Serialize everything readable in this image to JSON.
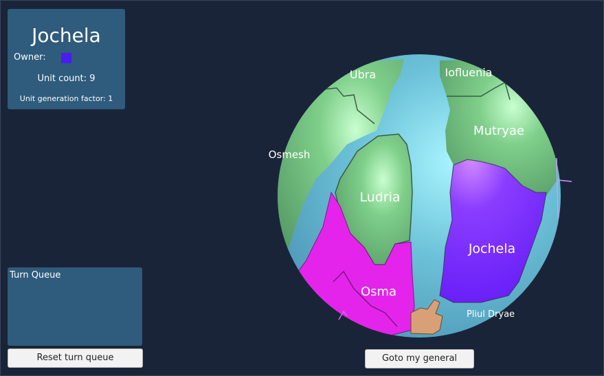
{
  "info_panel": {
    "region_name": "Jochela",
    "owner_label": "Owner:",
    "owner_color": "#4a1cf0",
    "unit_count_text": "Unit count: 9",
    "unit_generation_text": "Unit generation factor: 1"
  },
  "turn_queue": {
    "title": "Turn Queue",
    "reset_label": "Reset turn queue"
  },
  "globe": {
    "regions": {
      "ubra": "Ubra",
      "iofluenia": "Iofluenia",
      "mutryae": "Mutryae",
      "osmesh": "Osmesh",
      "ludria": "Ludria",
      "jochela": "Jochela",
      "osma": "Osma",
      "pliul_dryae": "Pliul Dryae"
    },
    "colors": {
      "ocean": "#5fb3cf",
      "neutral_land": "#5fa46e",
      "player_land": "#7a22ff",
      "enemy_land": "#e020e8"
    }
  },
  "controls": {
    "goto_general_label": "Goto my general"
  }
}
